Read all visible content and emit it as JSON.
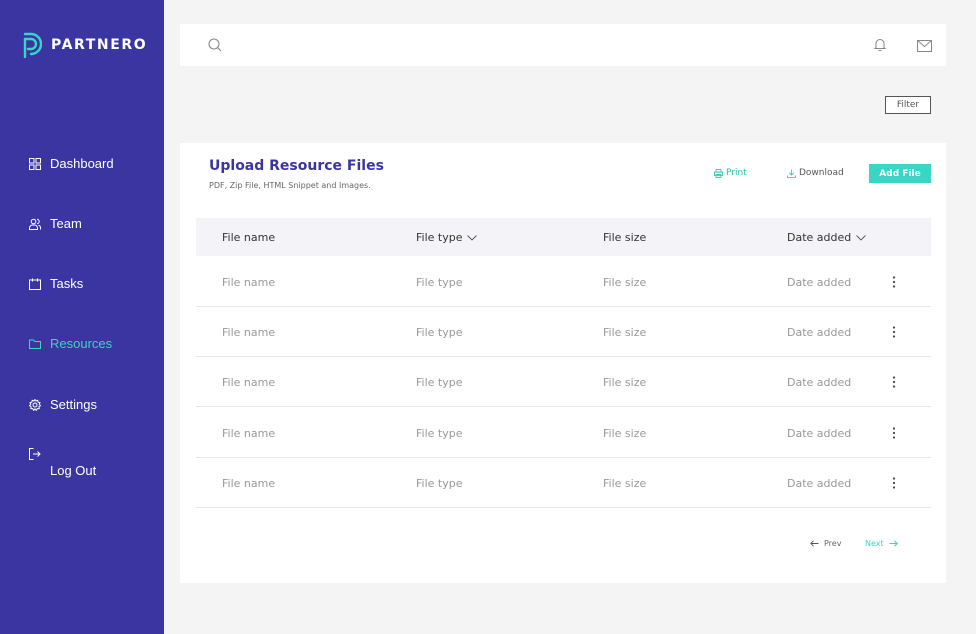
{
  "brand": {
    "name": "PARTNERO",
    "color": "#3ad6c5",
    "sidebar_bg": "#3a35a0"
  },
  "nav": {
    "items": [
      {
        "label": "Dashboard",
        "icon": "grid-icon"
      },
      {
        "label": "Team",
        "icon": "users-icon"
      },
      {
        "label": "Tasks",
        "icon": "calendar-icon"
      },
      {
        "label": "Resources",
        "icon": "folder-icon",
        "active": true
      },
      {
        "label": "Settings",
        "icon": "gear-icon"
      },
      {
        "label": "Log Out",
        "icon": "logout-icon"
      }
    ]
  },
  "topbar": {
    "icons": [
      "search-icon",
      "bell-icon",
      "mail-icon"
    ]
  },
  "toolbar": {
    "filter_label": "Filter"
  },
  "card": {
    "title": "Upload Resource Files",
    "subtitle": "PDF, Zip File, HTML Snippet and Images.",
    "print_label": "Print",
    "download_label": "Download",
    "add_label": "Add File"
  },
  "table": {
    "headers": [
      "File name",
      "File type",
      "File size",
      "Date added"
    ],
    "rows": [
      [
        "File name",
        "File type",
        "File size",
        "Date added"
      ],
      [
        "File name",
        "File type",
        "File size",
        "Date added"
      ],
      [
        "File name",
        "File type",
        "File size",
        "Date added"
      ],
      [
        "File name",
        "File type",
        "File size",
        "Date added"
      ],
      [
        "File name",
        "File type",
        "File size",
        "Date added"
      ]
    ]
  },
  "pagination": {
    "prev_label": "Prev",
    "next_label": "Next"
  }
}
